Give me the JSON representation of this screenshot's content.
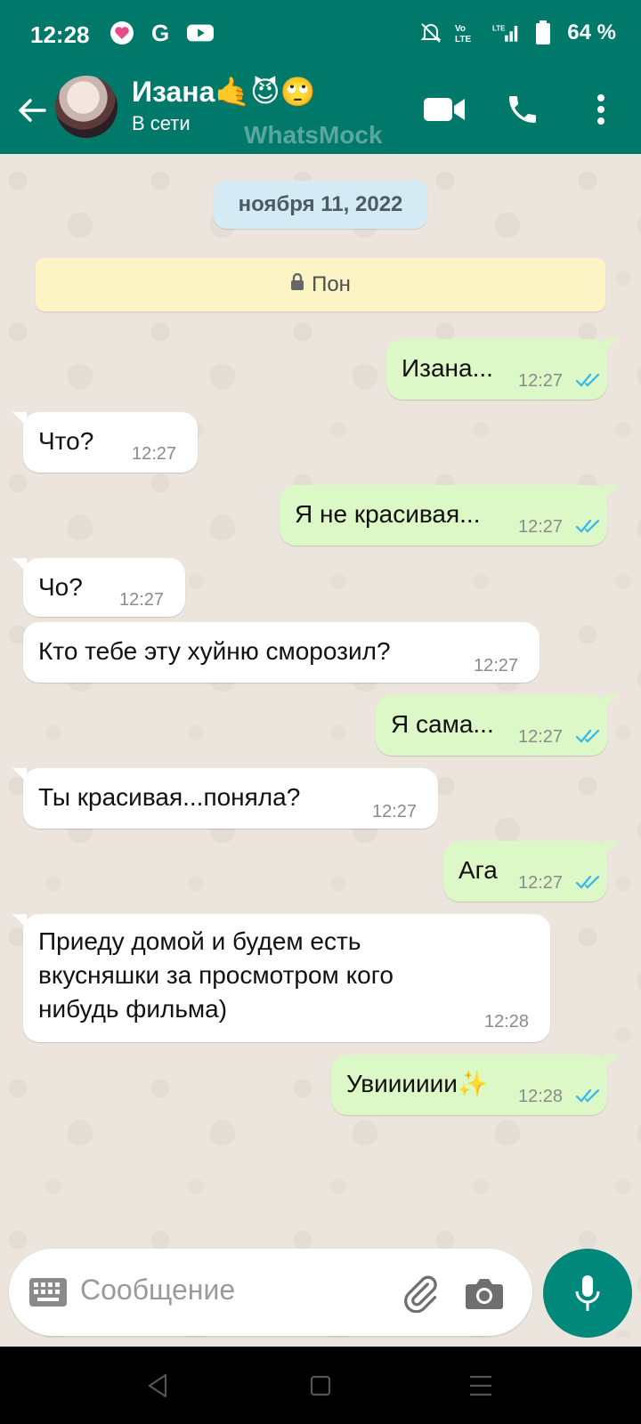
{
  "statusbar": {
    "time": "12:28",
    "battery": "64 %",
    "icons": [
      "likee-icon",
      "google-icon",
      "youtube-icon",
      "mute-icon",
      "volte-icon",
      "lte-signal-icon",
      "battery-icon"
    ]
  },
  "header": {
    "contact_name": "Изана🤙😈🙄",
    "status": "В сети",
    "watermark": "WhatsMock",
    "color": "#00796B"
  },
  "chat": {
    "date": "ноября 11, 2022",
    "notice": "Пон",
    "messages": [
      {
        "dir": "out",
        "text": "Изана...",
        "time": "12:27",
        "read": true
      },
      {
        "dir": "in",
        "text": "Что?",
        "time": "12:27"
      },
      {
        "dir": "out",
        "text": "Я не красивая...",
        "time": "12:27",
        "read": true
      },
      {
        "dir": "in",
        "text": "Чо?",
        "time": "12:27"
      },
      {
        "dir": "in",
        "text": "Кто тебе эту хуйню сморозил?",
        "time": "12:27"
      },
      {
        "dir": "out",
        "text": "Я сама...",
        "time": "12:27",
        "read": true
      },
      {
        "dir": "in",
        "text": "Ты красивая...поняла?",
        "time": "12:27"
      },
      {
        "dir": "out",
        "text": "Ага",
        "time": "12:27",
        "read": true
      },
      {
        "dir": "in",
        "text": "Приеду домой и будем есть\nвкусняшки за просмотром кого\nнибудь фильма)",
        "time": "12:28"
      },
      {
        "dir": "out",
        "text": "Увииииии✨",
        "time": "12:28",
        "read": true
      }
    ],
    "colors": {
      "incoming": "#FFFFFF",
      "outgoing": "#DCF8C6",
      "ticks": "#34B7F1"
    }
  },
  "input": {
    "placeholder": "Сообщение"
  }
}
